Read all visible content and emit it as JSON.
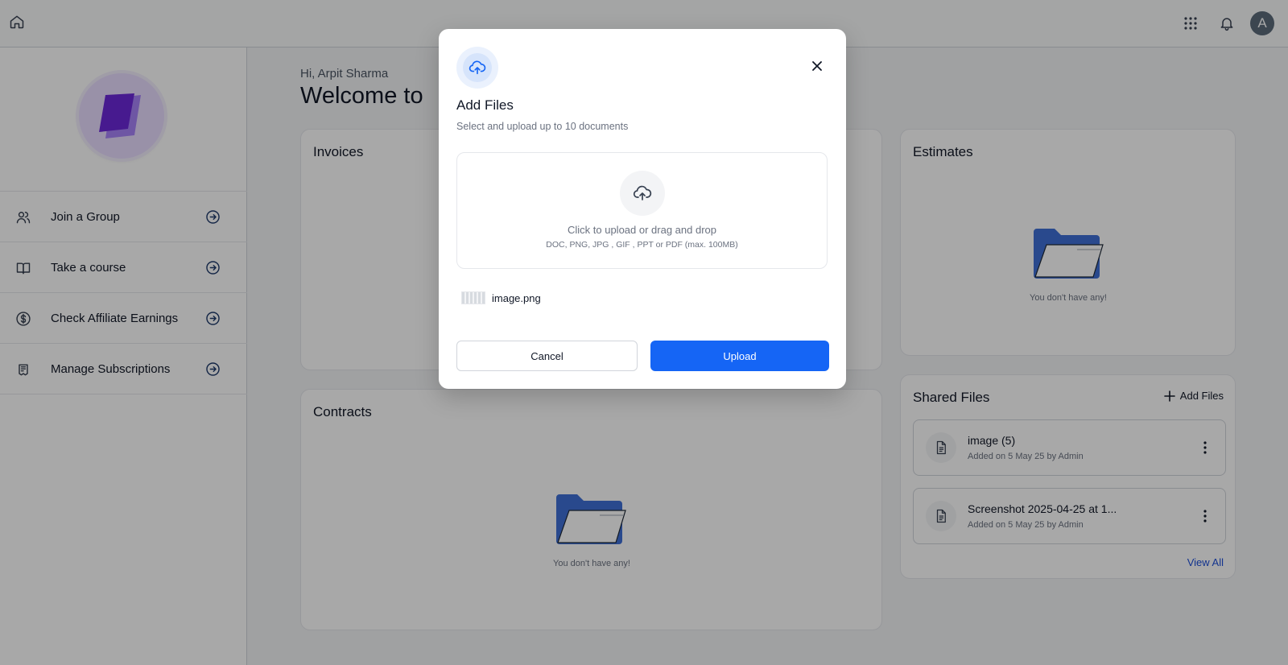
{
  "topbar": {
    "home_icon": "home-icon",
    "apps_icon": "grid-icon",
    "notifications_icon": "bell-icon",
    "avatar_initial": "A"
  },
  "sidebar": {
    "items": [
      {
        "label": "Join a Group",
        "icon": "users-icon"
      },
      {
        "label": "Take a course",
        "icon": "book-icon"
      },
      {
        "label": "Check Affiliate Earnings",
        "icon": "dollar-circle-icon"
      },
      {
        "label": "Manage Subscriptions",
        "icon": "receipt-icon"
      }
    ]
  },
  "main": {
    "greeting": "Hi, Arpit Sharma",
    "welcome": "Welcome to",
    "invoices_title": "Invoices",
    "contracts_title": "Contracts",
    "contracts_empty": "You don't have any!",
    "estimates_title": "Estimates",
    "estimates_empty": "You don't have any!",
    "shared_files": {
      "title": "Shared Files",
      "add_label": "Add Files",
      "view_all": "View All",
      "files": [
        {
          "name": "image (5)",
          "meta": "Added on 5 May 25 by Admin"
        },
        {
          "name": "Screenshot 2025-04-25 at 1...",
          "meta": "Added on 5 May 25 by Admin"
        }
      ]
    }
  },
  "modal": {
    "title": "Add Files",
    "subtitle": "Select and upload up to 10 documents",
    "dropzone_text": "Click to upload or drag and drop",
    "dropzone_note": "DOC, PNG, JPG , GIF , PPT or PDF (max. 100MB)",
    "selected_file": "image.png",
    "cancel_label": "Cancel",
    "upload_label": "Upload"
  },
  "colors": {
    "primary": "#1565f5",
    "link": "#1d4ed8",
    "folder": "#3f6fd6",
    "logo": "#7c3aed"
  }
}
